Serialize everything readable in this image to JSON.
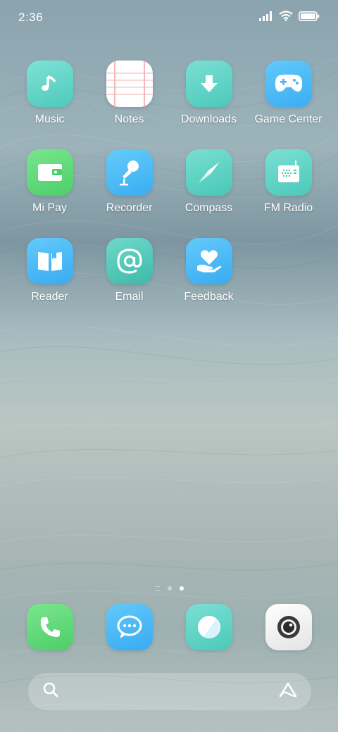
{
  "status_bar": {
    "time": "2:36",
    "icons": [
      "signal-icon",
      "wifi-icon",
      "battery-icon"
    ]
  },
  "apps": [
    {
      "label": "Music",
      "icon": "music-note-icon",
      "color": "#5fd6c8"
    },
    {
      "label": "Notes",
      "icon": "notes-paper-icon",
      "color": "#ffffff"
    },
    {
      "label": "Downloads",
      "icon": "download-arrow-icon",
      "color": "#57d5c6"
    },
    {
      "label": "Game Center",
      "icon": "gamepad-icon",
      "color": "#45b9f6"
    },
    {
      "label": "Mi Pay",
      "icon": "wallet-icon",
      "color": "#57d873"
    },
    {
      "label": "Recorder",
      "icon": "microphone-icon",
      "color": "#4db9f4"
    },
    {
      "label": "Compass",
      "icon": "compass-needle-icon",
      "color": "#55d2c3"
    },
    {
      "label": "FM Radio",
      "icon": "radio-icon",
      "color": "#55d4c6"
    },
    {
      "label": "Reader",
      "icon": "open-book-icon",
      "color": "#4ab7f3"
    },
    {
      "label": "Email",
      "icon": "at-sign-icon",
      "color": "#4ccbbb"
    },
    {
      "label": "Feedback",
      "icon": "heart-hand-icon",
      "color": "#4ab6f3"
    }
  ],
  "page_indicator": {
    "pages": 3,
    "current": 3
  },
  "dock": [
    {
      "icon": "phone-icon",
      "color": "#57d873"
    },
    {
      "icon": "message-bubble-icon",
      "color": "#48b9f4"
    },
    {
      "icon": "browser-icon",
      "color": "#57d5c6"
    },
    {
      "icon": "camera-icon",
      "color": "#f2f2f2"
    }
  ],
  "search_bar": {
    "left_icon": "search-icon",
    "right_icon": "assistant-icon"
  }
}
